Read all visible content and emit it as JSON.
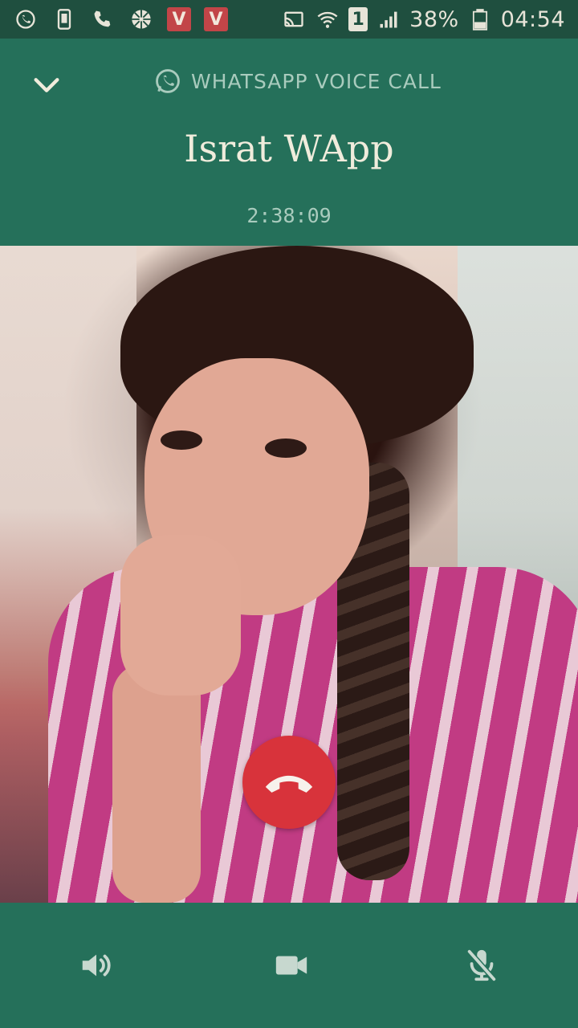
{
  "status_bar": {
    "battery_percent": "38%",
    "time": "04:54",
    "sim_label": "1",
    "app_badge_1": "V",
    "app_badge_2": "V",
    "icons": [
      "whatsapp-icon",
      "phone-outline-icon",
      "call-icon",
      "aperture-icon",
      "vivo-badge-icon",
      "vivo-badge-icon",
      "cast-icon",
      "wifi-icon",
      "sim-icon",
      "signal-icon",
      "battery-icon"
    ]
  },
  "header": {
    "call_type_label": "WHATSAPP VOICE CALL",
    "contact_name": "Israt WApp",
    "call_duration": "2:38:09"
  },
  "controls": {
    "speaker": "speaker-icon",
    "video": "video-icon",
    "mute": "mic-off-icon",
    "end_call": "end-call-icon"
  },
  "colors": {
    "header_bg": "#25705a",
    "status_bg": "#1f4f3f",
    "end_call": "#d8333b",
    "text_primary": "#f0ecdc",
    "text_secondary": "#a9cbbd"
  }
}
